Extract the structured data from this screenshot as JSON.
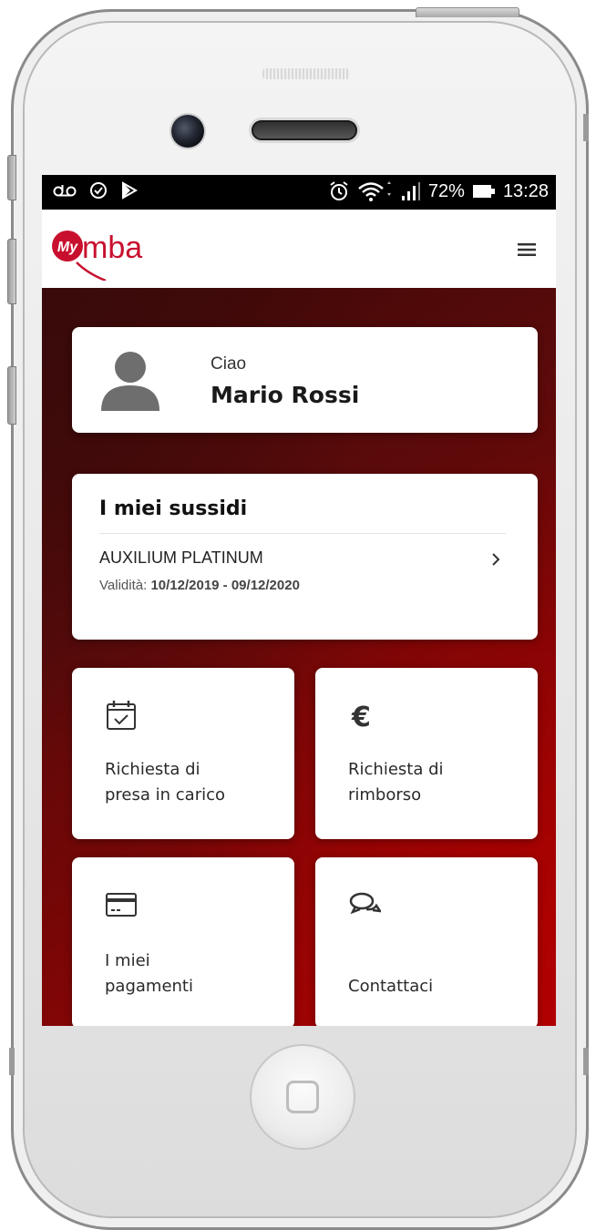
{
  "status_bar": {
    "battery_percent": "72%",
    "time": "13:28",
    "icons_left": [
      "voicemail-icon",
      "shield-icon",
      "play-icon"
    ],
    "icons_right": [
      "alarm-icon",
      "wifi-icon",
      "signal-icon",
      "battery-icon"
    ]
  },
  "header": {
    "logo_badge": "My",
    "logo_text": "mba",
    "menu_icon": "hamburger-menu-icon"
  },
  "greeting": {
    "hello": "Ciao",
    "user_name": "Mario Rossi"
  },
  "subsidies": {
    "title": "I miei sussidi",
    "items": [
      {
        "name": "AUXILIUM PLATINUM",
        "validity_label": "Validità:",
        "validity_range": "10/12/2019 - 09/12/2020"
      }
    ]
  },
  "tiles": [
    {
      "icon": "calendar-check-icon",
      "line1": "Richiesta di",
      "line2": "presa in carico"
    },
    {
      "icon": "euro-icon",
      "line1": "Richiesta di",
      "line2": "rimborso"
    },
    {
      "icon": "credit-card-icon",
      "line1": "I miei",
      "line2": "pagamenti"
    },
    {
      "icon": "chat-bubbles-icon",
      "line1": "",
      "line2": "Contattaci"
    }
  ],
  "colors": {
    "brand_red": "#c8102e",
    "background_dark": "#3b0808",
    "background_bright": "#a50505"
  }
}
